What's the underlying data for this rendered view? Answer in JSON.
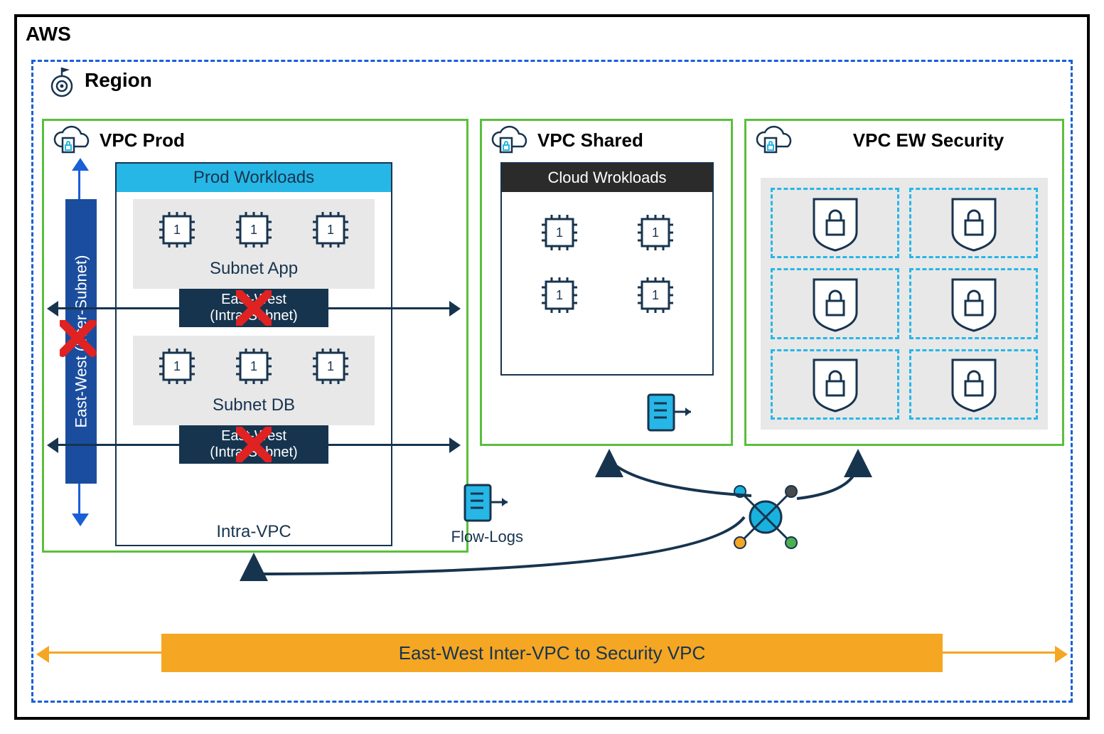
{
  "aws_label": "AWS",
  "region_label": "Region",
  "vpc_prod": {
    "title": "VPC Prod",
    "header": "Prod Workloads",
    "subnet_app_label": "Subnet App",
    "subnet_db_label": "Subnet DB",
    "ew_intra_line1": "East-West",
    "ew_intra_line2": "(Intra-Subnet)",
    "intra_vpc_label": "Intra-VPC",
    "inter_subnet_label": "East-West (Inter-Subnet)",
    "flow_logs_label": "Flow-Logs"
  },
  "vpc_shared": {
    "title": "VPC Shared",
    "header": "Cloud Wrokloads"
  },
  "vpc_security": {
    "title": "VPC EW Security"
  },
  "inter_vpc_label": "East-West Inter-VPC to Security VPC",
  "chip_glyph": "1",
  "colors": {
    "aws_border": "#000000",
    "region_dash": "#1a5fd6",
    "vpc_border": "#5bbf3d",
    "dark_navy": "#17344f",
    "cyan": "#26b7e6",
    "orange": "#f5a623",
    "red_x": "#e02222"
  }
}
